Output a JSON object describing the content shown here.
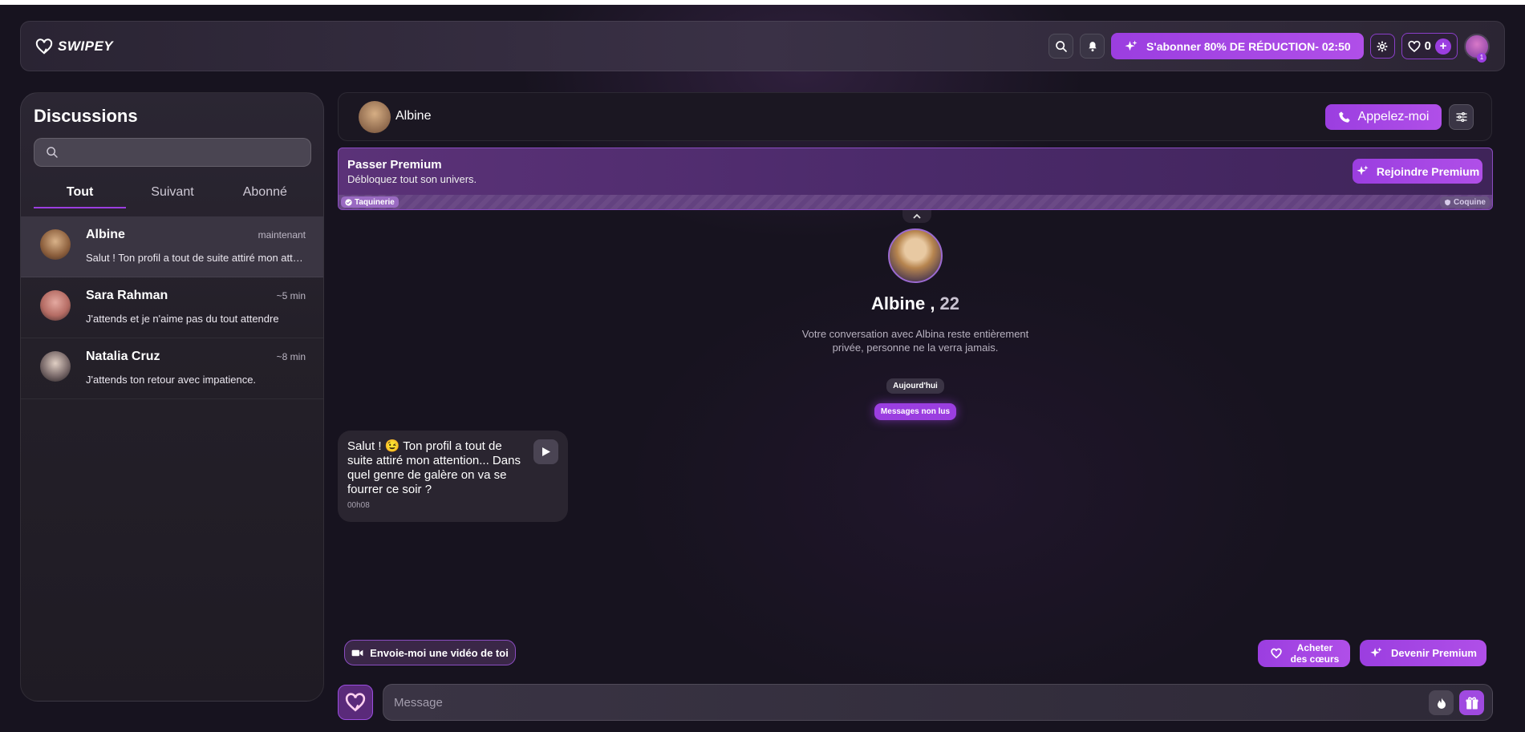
{
  "header": {
    "logo_text": "SWIPEY",
    "subscribe_label": "S'abonner 80% DE RÉDUCTION- 02:50",
    "hearts_count": "0",
    "notification_count": "1",
    "accent_color": "#9b3ee0"
  },
  "sidebar": {
    "title": "Discussions",
    "search_placeholder": "",
    "tabs": [
      {
        "label": "Tout",
        "active": true
      },
      {
        "label": "Suivant",
        "active": false
      },
      {
        "label": "Abonné",
        "active": false
      }
    ],
    "conversations": [
      {
        "name": "Albine",
        "time": "maintenant",
        "message": "Salut ! Ton profil a tout de suite attiré mon attention... Dans quel genre de galère on va se fourrer ce soir ?",
        "active": true
      },
      {
        "name": "Sara Rahman",
        "time": "~5 min",
        "message": "J'attends et je n'aime pas du tout attendre",
        "active": false
      },
      {
        "name": "Natalia Cruz",
        "time": "~8 min",
        "message": "J'attends ton retour avec impatience.",
        "active": false
      }
    ]
  },
  "chat": {
    "contact_name": "Albine",
    "call_label": "Appelez-moi",
    "premium_banner": {
      "title": "Passer Premium",
      "subtitle": "Débloquez tout son univers.",
      "button_label": "Rejoindre Premium",
      "level_current": "Taquinerie",
      "level_next": "Coquine"
    },
    "profile": {
      "name": "Albine",
      "age": "22",
      "privacy_note": "Votre conversation avec Albina reste entièrement privée, personne ne la verra jamais."
    },
    "date_pill": "Aujourd'hui",
    "unread_pill": "Messages non lus",
    "messages": [
      {
        "text": "Salut ! 😉 Ton profil a tout de suite attiré mon attention... Dans quel genre de galère on va se fourrer ce soir ?",
        "time": "00h08"
      }
    ],
    "suggestion_label": "Envoie-moi une vidéo de toi",
    "buy_hearts_label_1": "Acheter",
    "buy_hearts_label_2": "des cœurs",
    "become_premium_label": "Devenir Premium",
    "input_placeholder": "Message"
  }
}
